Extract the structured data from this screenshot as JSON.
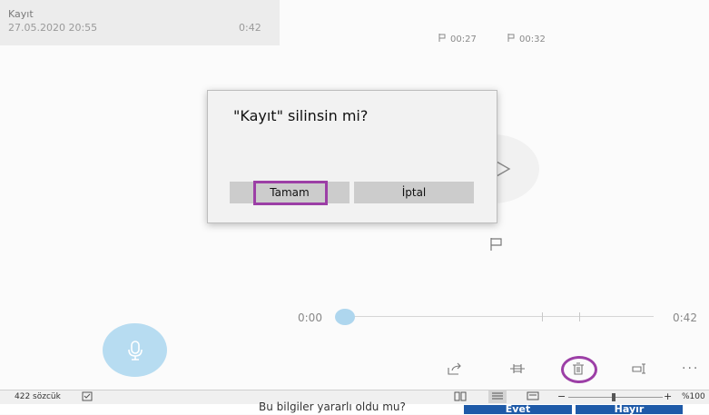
{
  "recording": {
    "name": "Kayıt",
    "date": "27.05.2020 20:55",
    "duration": "0:42"
  },
  "markers": [
    {
      "time": "00:27"
    },
    {
      "time": "00:32"
    }
  ],
  "timeline": {
    "start": "0:00",
    "end": "0:42",
    "position_fraction": 0.0
  },
  "dialog": {
    "title": "\"Kayıt\" silinsin mi?",
    "ok_label": "Tamam",
    "cancel_label": "İptal"
  },
  "statusbar": {
    "word_count": "422 sözcük",
    "zoom": "%100"
  },
  "background_prompt": {
    "question": "Bu bilgiler yararlı oldu mu?",
    "yes_label": "Evet",
    "no_label": "Hayır"
  },
  "colors": {
    "accent_highlight": "#9c3fa6",
    "mic_button": "#b7dcf1",
    "timeline_thumb": "#aed6ee",
    "feedback_button": "#1e5aa8"
  },
  "toolbar": {
    "icons": [
      "share-icon",
      "trim-icon",
      "delete-icon",
      "rename-icon",
      "more-icon"
    ],
    "more_label": "···"
  }
}
